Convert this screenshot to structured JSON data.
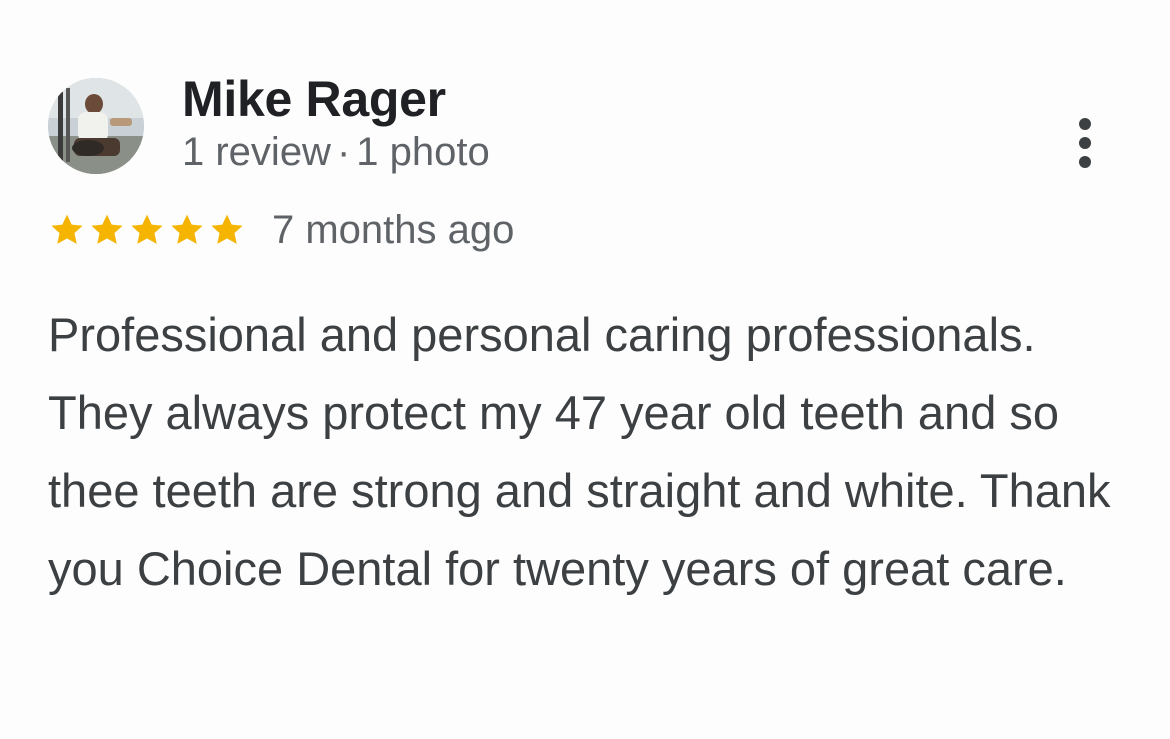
{
  "reviewer": {
    "name": "Mike Rager",
    "review_count": "1 review",
    "separator": "·",
    "photo_count": "1 photo",
    "avatar_icon": "profile-photo"
  },
  "rating": {
    "stars": 5,
    "max_stars": 5,
    "star_color": "#f4b400",
    "time_ago": "7 months ago"
  },
  "review": {
    "text": "Professional and personal caring professionals. They always protect my 47 year old teeth and so thee teeth are strong and straight and white. Thank you Choice Dental for twenty years of great care."
  },
  "menu": {
    "icon": "more-vert-icon"
  }
}
